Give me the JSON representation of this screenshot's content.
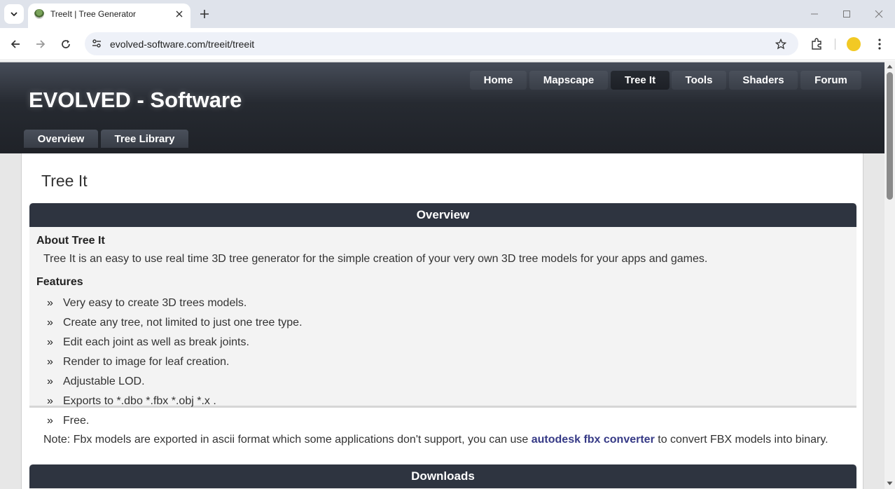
{
  "browser": {
    "tab_title": "TreeIt | Tree Generator",
    "url": "evolved-software.com/treeit/treeit"
  },
  "site": {
    "title": "EVOLVED - Software",
    "nav": [
      "Home",
      "Mapscape",
      "Tree It",
      "Tools",
      "Shaders",
      "Forum"
    ],
    "active_nav": "Tree It",
    "subnav": [
      "Overview",
      "Tree Library"
    ]
  },
  "page": {
    "heading": "Tree It",
    "overview": {
      "header": "Overview",
      "about_title": "About Tree It",
      "about_text": "Tree It is an easy to use real time 3D tree generator for the simple creation of your very own 3D tree models for your apps and games.",
      "features_title": "Features",
      "bullet_glyph": "»",
      "features": [
        "Very easy to create 3D trees models.",
        "Create any tree, not limited to just one tree type.",
        "Edit each joint as well as break joints.",
        "Render to image for leaf creation.",
        "Adjustable LOD.",
        "Exports to *.dbo *.fbx *.obj *.x .",
        "Free."
      ],
      "note_before": "Note: Fbx models are exported in ascii format which some applications don't support, you can use ",
      "note_link": "autodesk fbx converter",
      "note_after": " to convert FBX models into binary."
    },
    "downloads": {
      "header": "Downloads"
    }
  },
  "colors": {
    "header_dark": "#262a31",
    "section_head": "#2e3440",
    "link": "#363a86",
    "profile": "#f2c924"
  },
  "icons": [
    "tab-search-icon",
    "favicon-icon",
    "close-icon",
    "plus-icon",
    "minimize-icon",
    "maximize-icon",
    "back-icon",
    "forward-icon",
    "reload-icon",
    "site-info-icon",
    "star-icon",
    "extensions-icon",
    "profile-avatar",
    "more-menu-icon"
  ]
}
